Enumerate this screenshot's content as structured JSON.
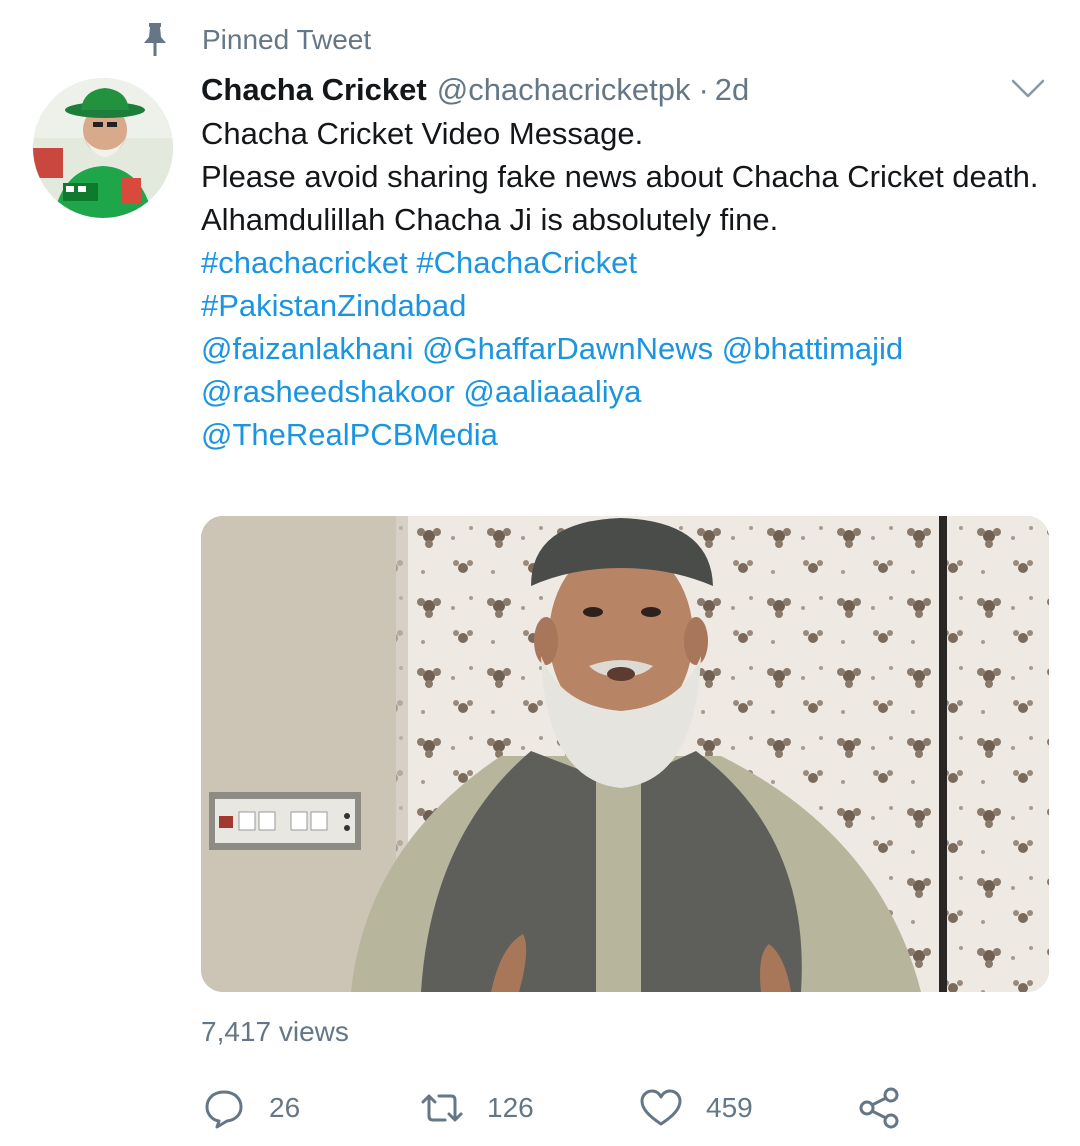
{
  "pinned": {
    "label": "Pinned Tweet",
    "icon": "pin-icon"
  },
  "author": {
    "name": "Chacha Cricket",
    "handle": "@chachacricketpk",
    "separator": "·",
    "time": "2d"
  },
  "tweet": {
    "line1": "Chacha Cricket Video Message.",
    "line2": "Please avoid sharing fake news about Chacha Cricket death.",
    "line3": "Alhamdulillah Chacha Ji is absolutely fine.",
    "hashtag1": "#chachacricket",
    "hashtag2": "#ChachaCricket",
    "hashtag3": "#PakistanZindabad",
    "mention1": "@faizanlakhani",
    "mention2": "@GhaffarDawnNews",
    "mention3": "@bhattimajid",
    "mention4": "@rasheedshakoor",
    "mention5": "@aaliaaaliya",
    "mention6": "@TheRealPCBMedia"
  },
  "views": "7,417 views",
  "actions": {
    "reply": {
      "icon": "reply-icon",
      "count": "26"
    },
    "retweet": {
      "icon": "retweet-icon",
      "count": "126"
    },
    "like": {
      "icon": "heart-icon",
      "count": "459"
    },
    "share": {
      "icon": "share-icon"
    }
  },
  "colors": {
    "link": "#1b95e0",
    "secondary": "#657786",
    "text": "#14171a"
  }
}
